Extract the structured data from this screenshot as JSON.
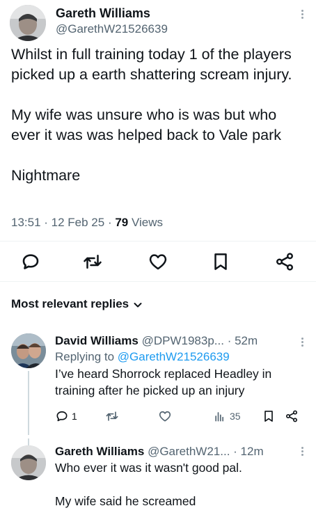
{
  "tweet": {
    "author_name": "Gareth Williams",
    "author_handle": "@GarethW21526639",
    "paragraph_1": "Whilst in full training today 1 of the players picked up a earth shattering scream injury.",
    "paragraph_2": "My wife was unsure who is was but who ever it was was helped back to Vale park",
    "paragraph_3": "Nightmare",
    "time": "13:51",
    "date": "12 Feb 25",
    "views_count": "79",
    "views_label": "Views",
    "separator": " · "
  },
  "actions": {
    "icons": [
      "reply-icon",
      "retweet-icon",
      "like-icon",
      "bookmark-icon",
      "share-icon"
    ]
  },
  "replies_header": {
    "label": "Most relevant replies"
  },
  "replies": [
    {
      "author_name": "David Williams",
      "author_handle": "@DPW1983p...",
      "age": "· 52m",
      "replying_prefix": "Replying to",
      "replying_handle": "@GarethW21526639",
      "text": "I’ve heard Shorrock replaced Headley in training after he picked up an injury",
      "reply_count": "1",
      "views_count": "35"
    },
    {
      "author_name": "Gareth Williams",
      "author_handle": "@GarethW21...",
      "age": "· 12m",
      "text_line_1": "Who ever it was it wasn't good pal.",
      "text_line_2": "My wife said he screamed"
    }
  ],
  "colors": {
    "accent": "#1d9bf0",
    "text": "#0f1419",
    "muted": "#536471",
    "divider": "#eff3f4"
  }
}
